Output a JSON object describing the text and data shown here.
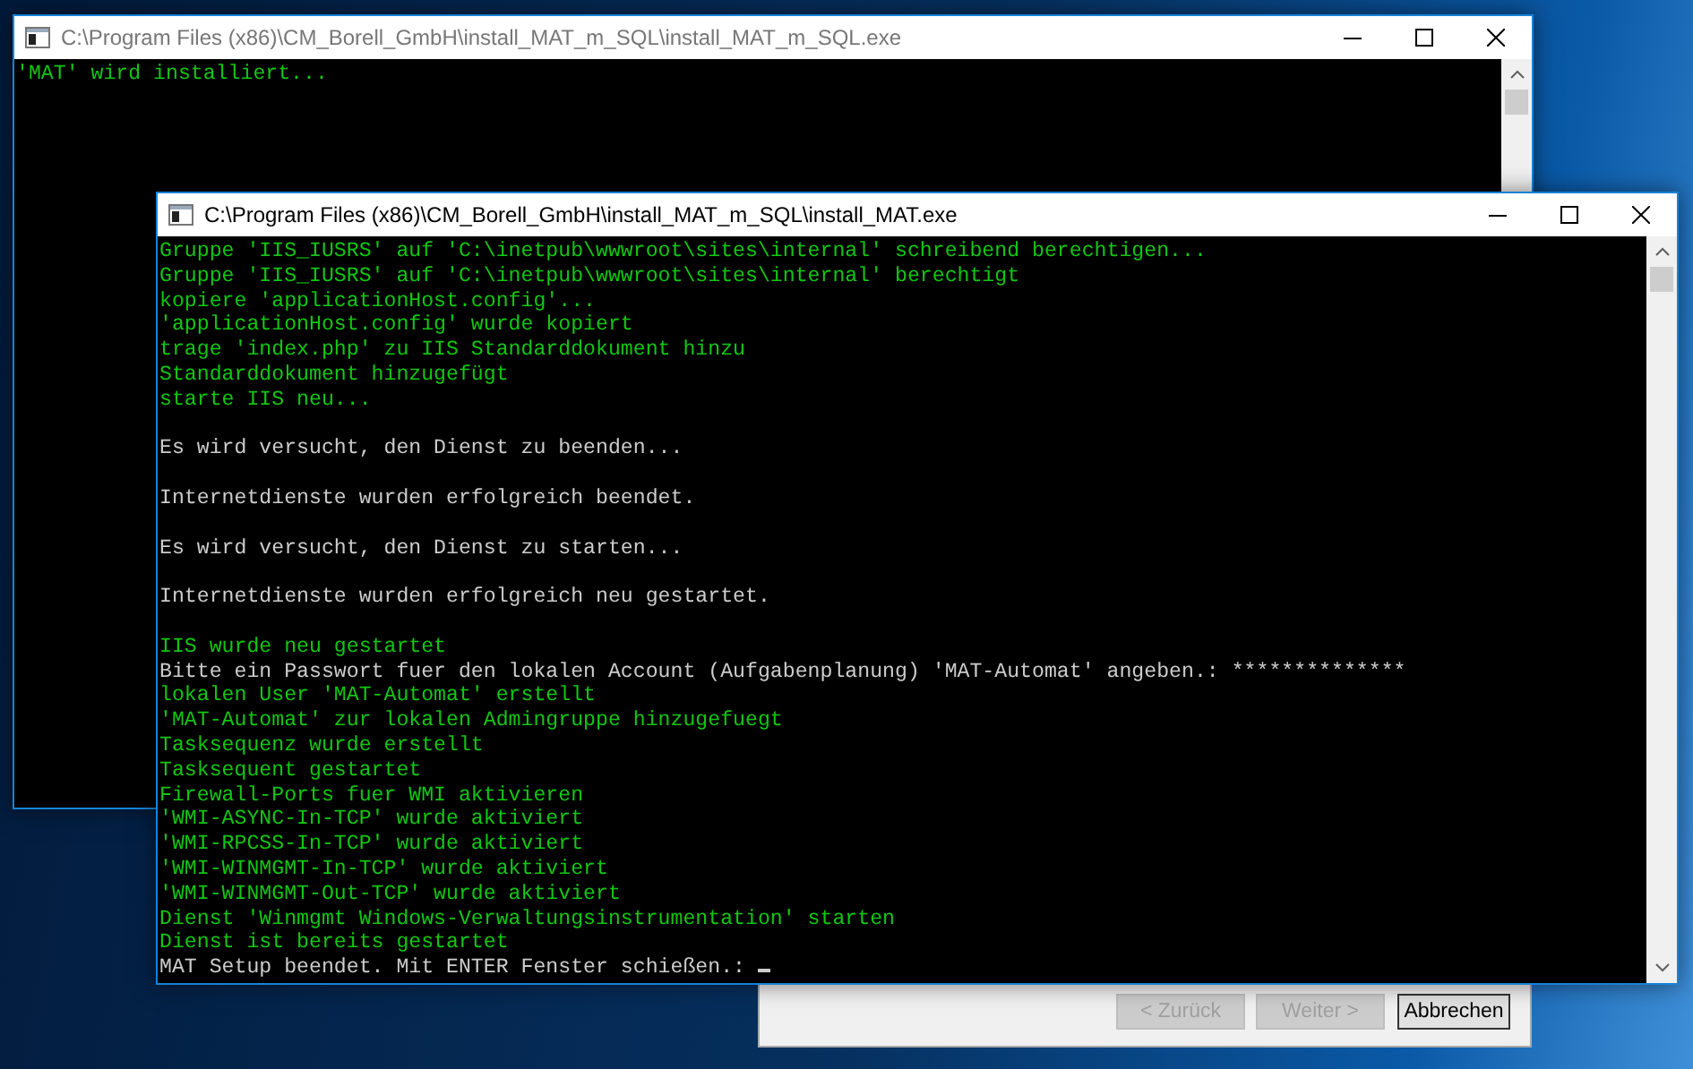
{
  "dialog": {
    "buttons": [
      {
        "label": "< Zurück",
        "disabled": true
      },
      {
        "label": "Weiter >",
        "disabled": true
      },
      {
        "label": "Abbrechen",
        "disabled": false
      }
    ]
  },
  "windows": [
    {
      "title": "C:\\Program Files (x86)\\CM_Borell_GmbH\\install_MAT_m_SQL\\install_MAT_m_SQL.exe",
      "active": false,
      "lines": [
        {
          "text": "'MAT' wird installiert...",
          "color": "#13c613"
        }
      ]
    },
    {
      "title": "C:\\Program Files (x86)\\CM_Borell_GmbH\\install_MAT_m_SQL\\install_MAT.exe",
      "active": true,
      "lines": [
        {
          "text": "Gruppe 'IIS_IUSRS' auf 'C:\\inetpub\\wwwroot\\sites\\internal' schreibend berechtigen...",
          "color": "#13c613"
        },
        {
          "text": "Gruppe 'IIS_IUSRS' auf 'C:\\inetpub\\wwwroot\\sites\\internal' berechtigt",
          "color": "#13c613"
        },
        {
          "text": "kopiere 'applicationHost.config'...",
          "color": "#13c613"
        },
        {
          "text": "'applicationHost.config' wurde kopiert",
          "color": "#13c613"
        },
        {
          "text": "trage 'index.php' zu IIS Standarddokument hinzu",
          "color": "#13c613"
        },
        {
          "text": "Standarddokument hinzugefügt",
          "color": "#13c613"
        },
        {
          "text": "starte IIS neu...",
          "color": "#13c613"
        },
        {
          "text": "Es wird versucht, den Dienst zu beenden...",
          "color": "#cccccc",
          "gap_before": true
        },
        {
          "text": "Internetdienste wurden erfolgreich beendet.",
          "color": "#cccccc",
          "gap_before": true
        },
        {
          "text": "Es wird versucht, den Dienst zu starten...",
          "color": "#cccccc",
          "gap_before": true
        },
        {
          "text": "Internetdienste wurden erfolgreich neu gestartet.",
          "color": "#cccccc",
          "gap_before": true
        },
        {
          "text": "IIS wurde neu gestartet",
          "color": "#13c613",
          "gap_before": true
        },
        {
          "text": "Bitte ein Passwort fuer den lokalen Account (Aufgabenplanung) 'MAT-Automat' angeben.: **************",
          "color": "#cccccc"
        },
        {
          "text": "lokalen User 'MAT-Automat' erstellt",
          "color": "#13c613"
        },
        {
          "text": "'MAT-Automat' zur lokalen Admingruppe hinzugefuegt",
          "color": "#13c613"
        },
        {
          "text": "Tasksequenz wurde erstellt",
          "color": "#13c613"
        },
        {
          "text": "Tasksequent gestartet",
          "color": "#13c613"
        },
        {
          "text": "Firewall-Ports fuer WMI aktivieren",
          "color": "#13c613"
        },
        {
          "text": "'WMI-ASYNC-In-TCP' wurde aktiviert",
          "color": "#13c613"
        },
        {
          "text": "'WMI-RPCSS-In-TCP' wurde aktiviert",
          "color": "#13c613"
        },
        {
          "text": "'WMI-WINMGMT-In-TCP' wurde aktiviert",
          "color": "#13c613"
        },
        {
          "text": "'WMI-WINMGMT-Out-TCP' wurde aktiviert",
          "color": "#13c613"
        },
        {
          "text": "Dienst 'Winmgmt Windows-Verwaltungsinstrumentation' starten",
          "color": "#13c613"
        },
        {
          "text": "Dienst ist bereits gestartet",
          "color": "#13c613"
        },
        {
          "text": "MAT Setup beendet. Mit ENTER Fenster schießen.:",
          "color": "#cccccc",
          "cursor": true
        }
      ]
    }
  ]
}
